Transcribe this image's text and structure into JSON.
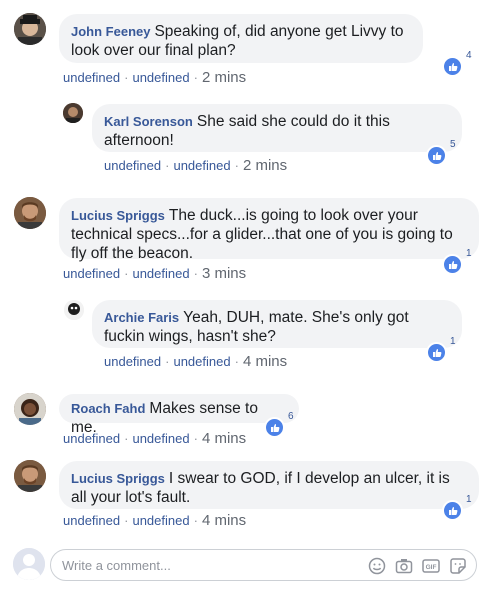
{
  "comments": [
    {
      "author": "John Feeney",
      "text": "Speaking of, did anyone get Livvy to look over our final plan?",
      "link1": "undefined",
      "link2": "undefined",
      "time": "2 mins",
      "reactions": "4"
    },
    {
      "author": "Karl Sorenson",
      "text": "She said she could do it this afternoon!",
      "link1": "undefined",
      "link2": "undefined",
      "time": "2 mins",
      "reactions": "5"
    },
    {
      "author": "Lucius Spriggs",
      "text": "The duck...is going to look over your technical specs...for a glider...that one of you is going to fly off the beacon.",
      "link1": "undefined",
      "link2": "undefined",
      "time": "3 mins",
      "reactions": "1"
    },
    {
      "author": "Archie Faris",
      "text": "Yeah, DUH, mate. She's only got fuckin wings, hasn't she?",
      "link1": "undefined",
      "link2": "undefined",
      "time": "4 mins",
      "reactions": "1"
    },
    {
      "author": "Roach Fahd",
      "text": "Makes sense to me.",
      "link1": "undefined",
      "link2": "undefined",
      "time": "4 mins",
      "reactions": "6"
    },
    {
      "author": "Lucius Spriggs",
      "text": "I swear to GOD, if I develop an ulcer, it is all your lot's fault.",
      "link1": "undefined",
      "link2": "undefined",
      "time": "4 mins",
      "reactions": "1"
    }
  ],
  "composer": {
    "placeholder": "Write a comment...",
    "icons": [
      "emoji-icon",
      "camera-icon",
      "gif-icon",
      "sticker-icon"
    ]
  },
  "colors": {
    "link": "#385898",
    "bubble": "#f2f3f5",
    "like": "#4c82e8"
  }
}
